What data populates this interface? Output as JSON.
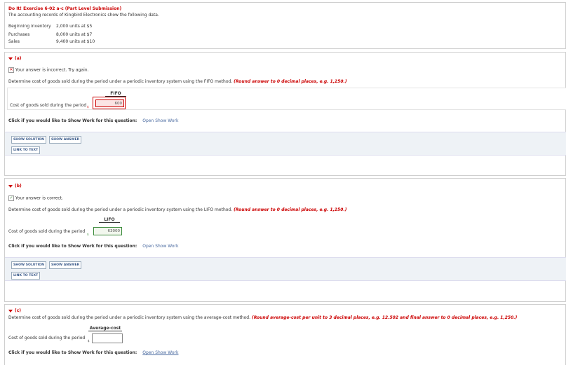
{
  "header": {
    "title": "Do It! Exercise 6-02 a-c (Part Level Submission)",
    "intro": "The accounting records of Kingbird Electronics show the following data.",
    "rows": [
      {
        "label": "Beginning inventory",
        "value": "2,000 units at  $5"
      },
      {
        "label": "Purchases",
        "value": "8,000 units at  $7"
      },
      {
        "label": "Sales",
        "value": "9,400 units at $10"
      }
    ]
  },
  "part_a": {
    "label": "(a)",
    "feedback": "Your answer is incorrect.  Try again.",
    "question": "Determine cost of goods sold during the period under a periodic inventory system using the FIFO method.",
    "hint": "(Round answer to 0 decimal places, e.g. 1,250.)",
    "column_header": "FIFO",
    "row_label": "Cost of goods sold during the period",
    "input_value": "600",
    "show_work_prompt": "Click if you would like to Show Work for this question:",
    "show_work_link": "Open Show Work",
    "show_solution": "SHOW SOLUTION",
    "show_answer": "SHOW ANSWER",
    "link_to_text": "LINK TO TEXT"
  },
  "part_b": {
    "label": "(b)",
    "feedback": "Your answer is correct.",
    "question": "Determine cost of goods sold during the period under a periodic inventory system using the LIFO method.",
    "hint": "(Round answer to 0 decimal places, e.g. 1,250.)",
    "column_header": "LIFO",
    "row_label": "Cost of goods sold during the period",
    "input_value": "63000",
    "show_work_prompt": "Click if you would like to Show Work for this question:",
    "show_work_link": "Open Show Work",
    "show_solution": "SHOW SOLUTION",
    "show_answer": "SHOW ANSWER",
    "link_to_text": "LINK TO TEXT"
  },
  "part_c": {
    "label": "(c)",
    "question": "Determine cost of goods sold during the period under a periodic inventory system using the average-cost method.",
    "hint": "(Round average-cost per unit to 3 decimal places, e.g. 12.502 and final answer to 0 decimal places, e.g. 1,250.)",
    "column_header": "Average-cost",
    "row_label": "Cost of goods sold during the period",
    "input_value": "",
    "show_work_prompt": "Click if you would like to Show Work for this question:",
    "show_work_link": "Open Show Work"
  },
  "currency_symbol": "$",
  "colors": {
    "accent_red": "#cc0000",
    "correct_green": "#3a8a3a",
    "link_blue": "#4a6aa0"
  }
}
